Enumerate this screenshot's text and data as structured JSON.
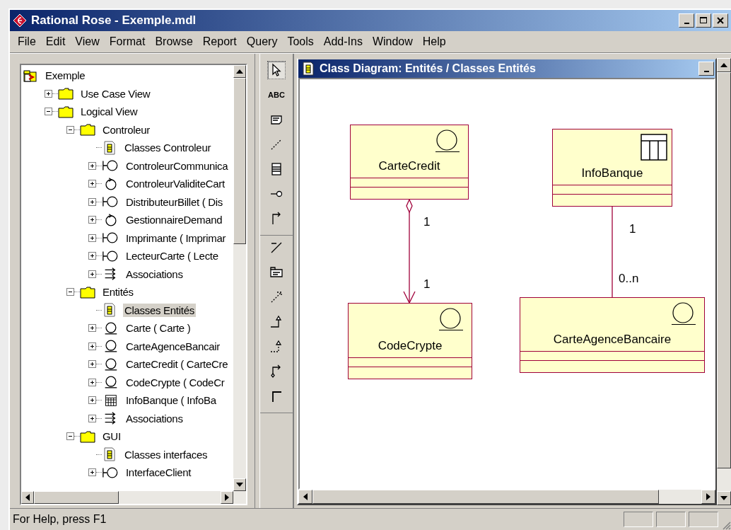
{
  "window": {
    "title": "Rational Rose - Exemple.mdl"
  },
  "menu": [
    "File",
    "Edit",
    "View",
    "Format",
    "Browse",
    "Report",
    "Query",
    "Tools",
    "Add-Ins",
    "Window",
    "Help"
  ],
  "tree": [
    {
      "label": "Exemple",
      "kind": "model",
      "selected": false,
      "children": [
        {
          "label": "Use Case View",
          "kind": "folder",
          "expanded": false,
          "selected": false
        },
        {
          "label": "Logical View",
          "kind": "folder",
          "expanded": true,
          "selected": false,
          "children": [
            {
              "label": "Controleur",
              "kind": "folder",
              "expanded": true,
              "selected": false,
              "children": [
                {
                  "label": "Classes Controleur",
                  "kind": "diagram",
                  "selected": false
                },
                {
                  "label": "ControleurCommunica",
                  "kind": "boundary",
                  "expanded": false,
                  "selected": false
                },
                {
                  "label": "ControleurValiditeCart",
                  "kind": "control",
                  "expanded": false,
                  "selected": false
                },
                {
                  "label": "DistributeurBillet ( Dis",
                  "kind": "boundary",
                  "expanded": false,
                  "selected": false
                },
                {
                  "label": "GestionnaireDemand",
                  "kind": "control",
                  "expanded": false,
                  "selected": false
                },
                {
                  "label": "Imprimante ( Imprimar",
                  "kind": "boundary",
                  "expanded": false,
                  "selected": false
                },
                {
                  "label": "LecteurCarte ( Lecte",
                  "kind": "boundary",
                  "expanded": false,
                  "selected": false
                },
                {
                  "label": "Associations",
                  "kind": "associations",
                  "expanded": false,
                  "selected": false
                }
              ]
            },
            {
              "label": "Entités",
              "kind": "folder",
              "expanded": true,
              "selected": false,
              "children": [
                {
                  "label": "Classes Entités",
                  "kind": "diagram",
                  "selected": true
                },
                {
                  "label": "Carte ( Carte )",
                  "kind": "entity",
                  "expanded": false,
                  "selected": false
                },
                {
                  "label": "CarteAgenceBancair",
                  "kind": "entity",
                  "expanded": false,
                  "selected": false
                },
                {
                  "label": "CarteCredit ( CarteCre",
                  "kind": "entity",
                  "expanded": false,
                  "selected": false
                },
                {
                  "label": "CodeCrypte ( CodeCr",
                  "kind": "entity",
                  "expanded": false,
                  "selected": false
                },
                {
                  "label": "InfoBanque ( InfoBa",
                  "kind": "table",
                  "expanded": false,
                  "selected": false
                },
                {
                  "label": "Associations",
                  "kind": "associations",
                  "expanded": false,
                  "selected": false
                }
              ]
            },
            {
              "label": "GUI",
              "kind": "folder",
              "expanded": true,
              "selected": false,
              "children": [
                {
                  "label": "Classes interfaces",
                  "kind": "diagram",
                  "selected": false
                },
                {
                  "label": "InterfaceClient",
                  "kind": "boundary",
                  "expanded": false,
                  "selected": false
                }
              ]
            }
          ]
        }
      ]
    }
  ],
  "toolbox": {
    "groups": [
      [
        {
          "kind": "pointer",
          "selected": true
        },
        {
          "kind": "text",
          "label": "ABC",
          "selected": false
        },
        {
          "kind": "note",
          "selected": false
        },
        {
          "kind": "anchor",
          "selected": false
        },
        {
          "kind": "class",
          "selected": false
        },
        {
          "kind": "interface",
          "selected": false
        },
        {
          "kind": "association",
          "selected": false
        }
      ],
      [
        {
          "kind": "association-class",
          "selected": false
        },
        {
          "kind": "package",
          "selected": false
        },
        {
          "kind": "dependency",
          "selected": false
        },
        {
          "kind": "generalization",
          "selected": false
        },
        {
          "kind": "realization",
          "selected": false
        },
        {
          "kind": "aggregation",
          "selected": false
        },
        {
          "kind": "corner",
          "selected": false
        }
      ]
    ]
  },
  "diagram": {
    "title": "Class Diagram: Entités / Classes Entités",
    "links": [
      {
        "kind": "aggregation",
        "source": {
          "name": "CarteCredit",
          "kind": "entity"
        },
        "source_multiplicity": "1",
        "target": {
          "name": "CodeCrypte",
          "kind": "entity"
        },
        "target_multiplicity": "1"
      },
      {
        "kind": "association",
        "source": {
          "name": "InfoBanque",
          "kind": "table"
        },
        "source_multiplicity": "1",
        "target": {
          "name": "CarteAgenceBancaire",
          "kind": "entity"
        },
        "target_multiplicity": "0..n"
      }
    ]
  },
  "status_bar": {
    "text": "For Help, press F1"
  }
}
